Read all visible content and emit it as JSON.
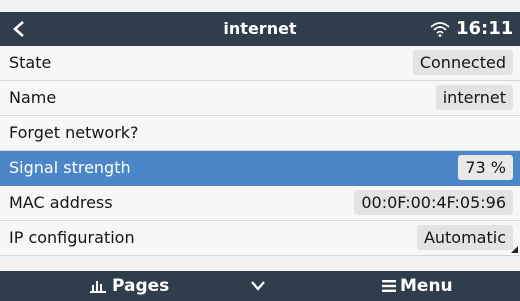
{
  "header": {
    "title": "internet",
    "time": "16:11",
    "back_icon": "chevron-left-icon",
    "wifi_icon": "wifi-icon"
  },
  "rows": [
    {
      "label": "State",
      "value": "Connected"
    },
    {
      "label": "Name",
      "value": "internet"
    },
    {
      "label": "Forget network?",
      "value": ""
    },
    {
      "label": "Signal strength",
      "value": "73 %",
      "selected": true
    },
    {
      "label": "MAC address",
      "value": "00:0F:00:4F:05:96"
    },
    {
      "label": "IP configuration",
      "value": "Automatic"
    }
  ],
  "footer": {
    "pages_label": "Pages",
    "menu_label": "Menu",
    "pages_icon": "bar-chart-icon",
    "down_icon": "chevron-down-icon",
    "menu_icon": "hamburger-menu-icon"
  },
  "colors": {
    "bar_background": "#2f3d4c",
    "selection": "#4a86c8"
  }
}
